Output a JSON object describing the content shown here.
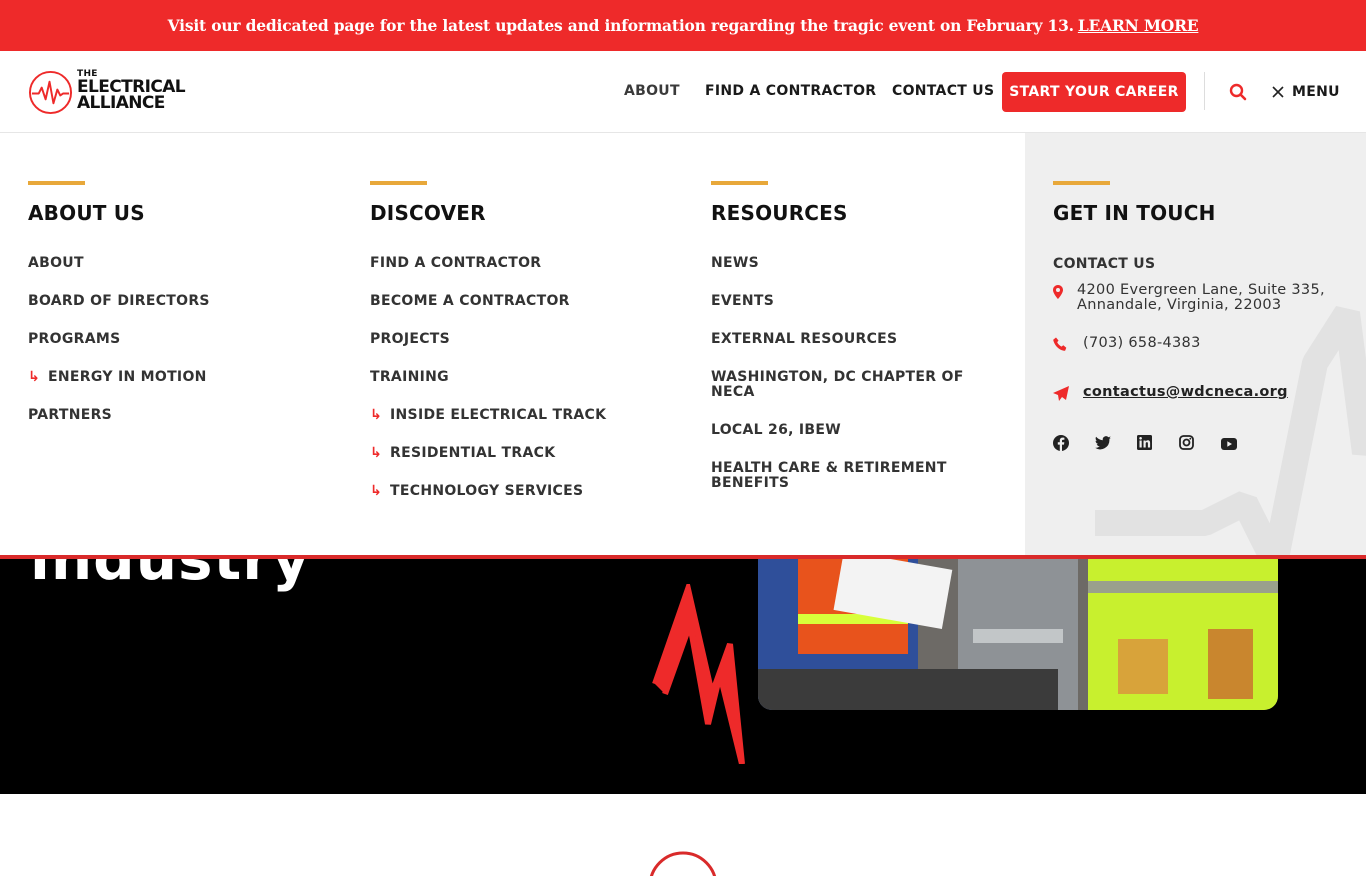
{
  "alert": {
    "message": "Visit our dedicated page for the latest updates and information regarding the tragic event on February 13.",
    "link": "LEARN MORE"
  },
  "logo": {
    "top": "THE",
    "line1": "ELECTRICAL",
    "line2": "ALLIANCE"
  },
  "nav": {
    "about": "ABOUT",
    "find": "FIND A CONTRACTOR",
    "contact": "CONTACT US",
    "cta": "START YOUR CAREER",
    "menu": "MENU"
  },
  "mega": {
    "about_us": {
      "title": "ABOUT US",
      "items": [
        "ABOUT",
        "BOARD OF DIRECTORS",
        "PROGRAMS",
        "ENERGY IN MOTION",
        "PARTNERS"
      ]
    },
    "discover": {
      "title": "DISCOVER",
      "items": [
        "FIND A CONTRACTOR",
        "BECOME A CONTRACTOR",
        "PROJECTS",
        "TRAINING",
        "INSIDE ELECTRICAL TRACK",
        "RESIDENTIAL TRACK",
        "TECHNOLOGY SERVICES"
      ]
    },
    "resources": {
      "title": "RESOURCES",
      "items": [
        "NEWS",
        "EVENTS",
        "EXTERNAL RESOURCES",
        "WASHINGTON, DC CHAPTER OF NECA",
        "LOCAL 26, IBEW",
        "HEALTH CARE & RETIREMENT BENEFITS"
      ]
    },
    "get_in_touch": {
      "title": "GET IN TOUCH",
      "contact_label": "CONTACT US",
      "address_line1": "4200 Evergreen Lane, Suite 335,",
      "address_line2": "Annandale, Virginia, 22003",
      "phone": "(703) 658-4383",
      "email": "contactus@wdcneca.org",
      "social": [
        "facebook-icon",
        "twitter-icon",
        "linkedin-icon",
        "instagram-icon",
        "youtube-icon"
      ]
    }
  },
  "hero": {
    "title_fragment": "industry"
  },
  "colors": {
    "red": "#ee2a2a",
    "gold": "#e8a83a",
    "side_bg": "#efefef",
    "hero_bg": "#000000"
  }
}
